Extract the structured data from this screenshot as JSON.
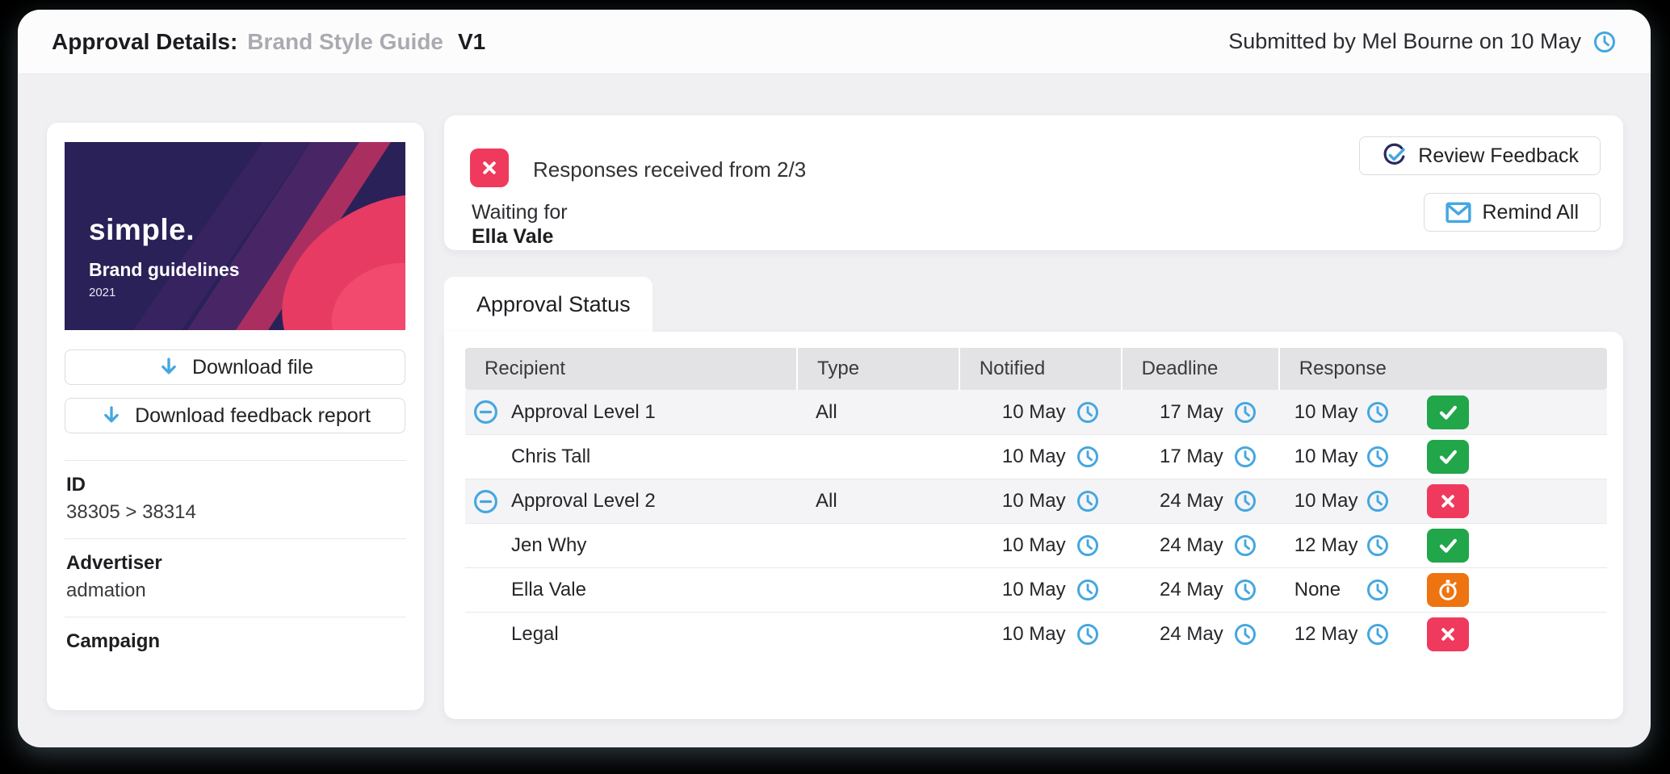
{
  "header": {
    "title_label": "Approval Details:",
    "document_name": "Brand Style Guide",
    "version": "V1",
    "submitted_text": "Submitted by Mel Bourne on 10 May"
  },
  "file_card": {
    "preview": {
      "logo": "simple.",
      "title": "Brand guidelines",
      "year": "2021"
    },
    "download_file_label": "Download file",
    "download_report_label": "Download feedback report",
    "meta": [
      {
        "label": "ID",
        "value": "38305 > 38314"
      },
      {
        "label": "Advertiser",
        "value": "admation"
      },
      {
        "label": "Campaign",
        "value": ""
      }
    ]
  },
  "status_card": {
    "status_text": "Responses received from 2/3",
    "waiting_label": "Waiting for",
    "waiting_name": "Ella Vale",
    "review_button_label": "Review Feedback",
    "remind_button_label": "Remind All"
  },
  "approval": {
    "tab_label": "Approval Status",
    "columns": [
      "Recipient",
      "Type",
      "Notified",
      "Deadline",
      "Response"
    ],
    "rows": [
      {
        "recipient": "Approval Level 1",
        "type": "All",
        "notified": "10 May",
        "deadline": "17 May",
        "response": "10 May",
        "status": "approved",
        "level": true
      },
      {
        "recipient": "Chris Tall",
        "type": "",
        "notified": "10 May",
        "deadline": "17 May",
        "response": "10 May",
        "status": "approved",
        "level": false
      },
      {
        "recipient": "Approval Level 2",
        "type": "All",
        "notified": "10 May",
        "deadline": "24 May",
        "response": "10 May",
        "status": "rejected",
        "level": true
      },
      {
        "recipient": "Jen Why",
        "type": "",
        "notified": "10 May",
        "deadline": "24 May",
        "response": "12 May",
        "status": "approved",
        "level": false
      },
      {
        "recipient": "Ella Vale",
        "type": "",
        "notified": "10 May",
        "deadline": "24 May",
        "response": "None",
        "status": "pending",
        "level": false
      },
      {
        "recipient": "Legal",
        "type": "",
        "notified": "10 May",
        "deadline": "24 May",
        "response": "12 May",
        "status": "rejected",
        "level": false
      }
    ]
  },
  "icons": {
    "clock": "clock-icon",
    "download": "arrow-down-icon",
    "review": "review-check-icon",
    "remind": "envelope-icon",
    "collapse": "minus-circle-icon",
    "approved": "check-icon",
    "rejected": "x-icon",
    "pending": "stopwatch-icon"
  },
  "colors": {
    "accent_blue": "#45a7e0",
    "green": "#21a64a",
    "red": "#ef3a5d",
    "orange": "#ee7411",
    "navy": "#2b2a5e",
    "artwork_bg": "#2a2158"
  }
}
